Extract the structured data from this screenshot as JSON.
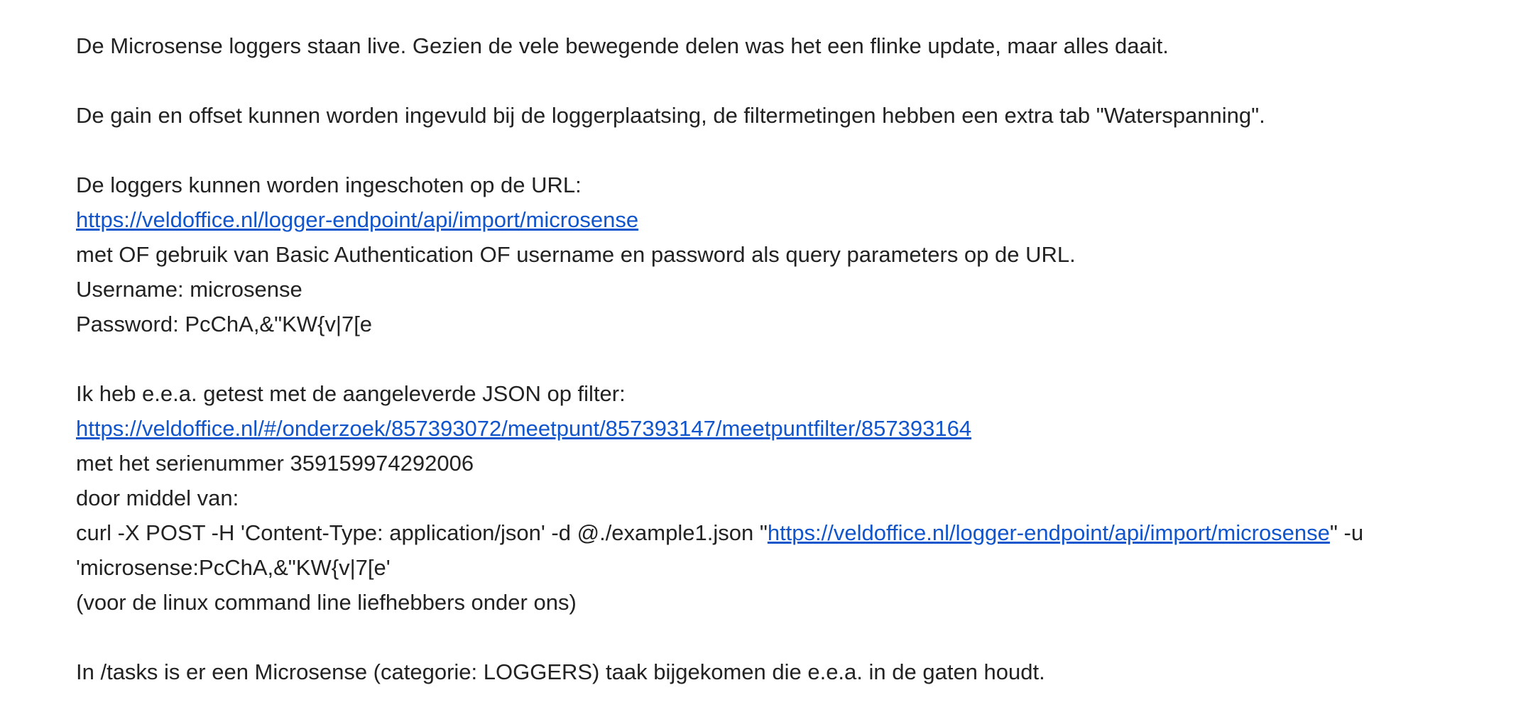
{
  "email": {
    "intro": "De Microsense loggers staan live. Gezien de vele bewegende delen was het een flinke update, maar alles daait.",
    "gain_offset": "De gain en offset kunnen worden ingevuld bij de loggerplaatsing, de filtermetingen hebben een extra tab \"Waterspanning\".",
    "url_intro": "De loggers kunnen worden ingeschoten op de URL:",
    "endpoint_url": "https://veldoffice.nl/logger-endpoint/api/import/microsense",
    "auth_text": "met OF gebruik van Basic Authentication OF username en password als query parameters op de URL.",
    "username_line": "Username: microsense",
    "password_line": "Password: PcChA,&\"KW{v|7[e",
    "test_intro": "Ik heb e.e.a. getest met de aangeleverde JSON op filter:",
    "filter_url": "https://veldoffice.nl/#/onderzoek/857393072/meetpunt/857393147/meetpuntfilter/857393164",
    "serial_line": "met het serienummer 359159974292006",
    "means_line": "door middel van:",
    "curl_prefix": "curl -X POST -H 'Content-Type: application/json' -d @./example1.json \"",
    "curl_url": "https://veldoffice.nl/logger-endpoint/api/import/microsense",
    "curl_suffix": "\" -u",
    "curl_creds": "'microsense:PcChA,&\"KW{v|7[e'",
    "linux_note": "(voor de linux command line liefhebbers onder ons)",
    "tasks_line": "In /tasks is er een Microsense (categorie: LOGGERS) taak bijgekomen die e.e.a. in de gaten houdt."
  }
}
